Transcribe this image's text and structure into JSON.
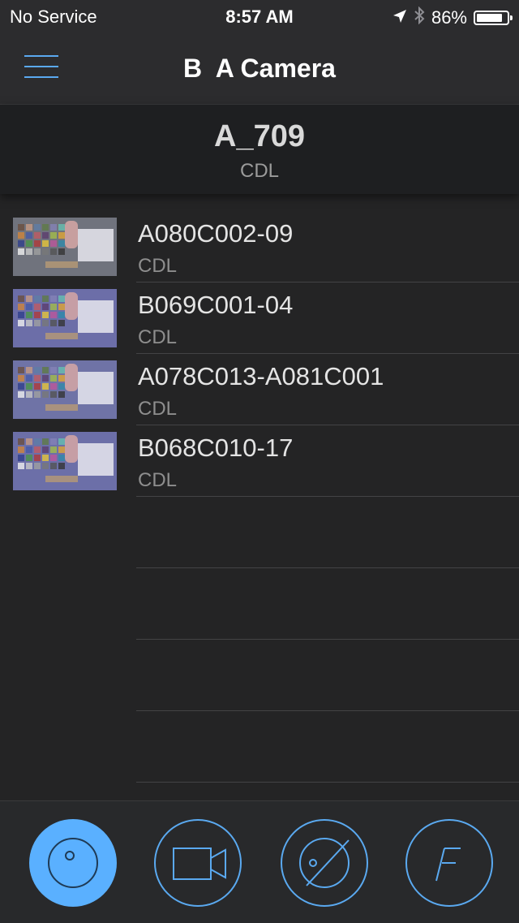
{
  "status_bar": {
    "carrier": "No Service",
    "time": "8:57 AM",
    "battery_percent": "86%",
    "battery_level": 0.86,
    "icons": [
      "location-arrow-icon",
      "bluetooth-icon",
      "battery-icon"
    ]
  },
  "nav": {
    "title": "B  A Camera",
    "menu_icon": "hamburger-menu-icon"
  },
  "look": {
    "name": "A_709",
    "type": "CDL"
  },
  "clips": [
    {
      "name": "A080C002-09",
      "type": "CDL"
    },
    {
      "name": "B069C001-04",
      "type": "CDL"
    },
    {
      "name": "A078C013-A081C001",
      "type": "CDL"
    },
    {
      "name": "B068C010-17",
      "type": "CDL"
    }
  ],
  "tabs": [
    {
      "icon": "lens-circle-icon",
      "active": true
    },
    {
      "icon": "video-camera-icon",
      "active": false
    },
    {
      "icon": "exposure-icon",
      "active": false
    },
    {
      "icon": "f-stop-icon",
      "label": "F",
      "active": false
    }
  ],
  "colors": {
    "accent": "#5aa9f0",
    "active_tab": "#5ab0ff",
    "background": "#242425"
  }
}
